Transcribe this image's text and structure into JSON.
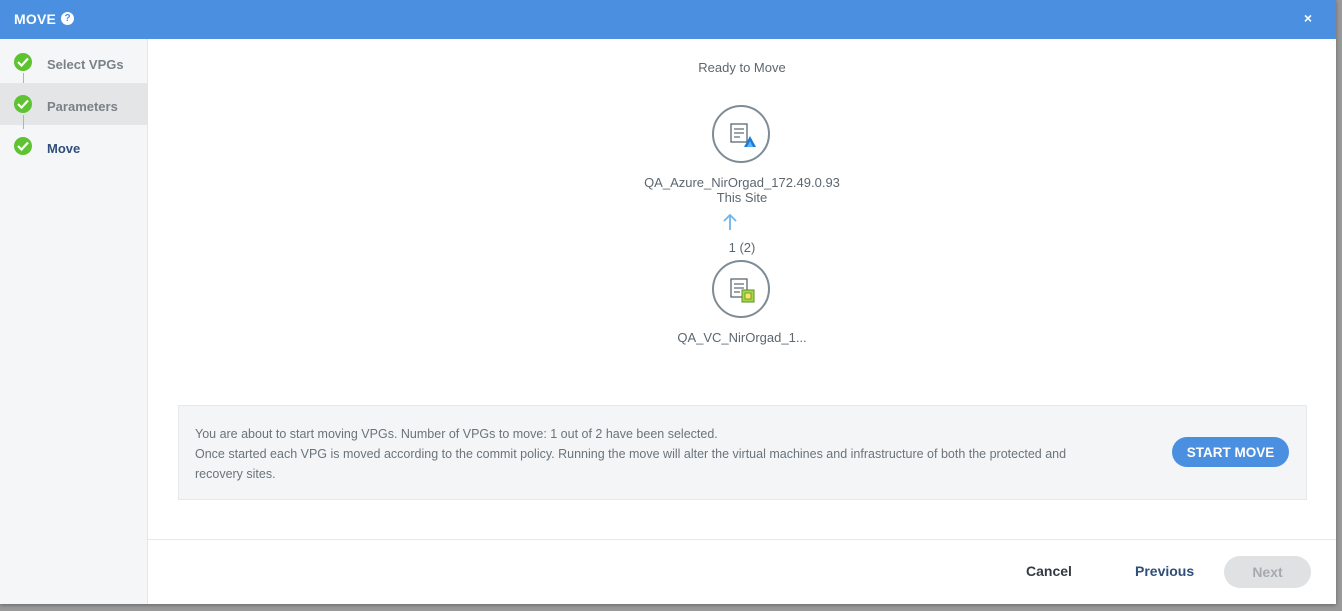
{
  "window": {
    "title": "MOVE",
    "help_icon": "question-circle-icon",
    "help_glyph": "?",
    "close_icon": "close-icon",
    "close_glyph": "×",
    "accent_color": "#4a8fe0"
  },
  "sidebar": {
    "steps": [
      {
        "label": "Select VPGs",
        "status": "complete"
      },
      {
        "label": "Parameters",
        "status": "complete"
      },
      {
        "label": "Move",
        "status": "current"
      }
    ],
    "check_color": "#5ec232"
  },
  "main": {
    "status_text": "Ready to Move",
    "target_site": {
      "name": "QA_Azure_NirOrgad_172.49.0.93",
      "subtitle": "This Site",
      "icon": "azure-site-icon"
    },
    "direction_icon": "arrow-up-icon",
    "vpg_count": "1 (2)",
    "source_site": {
      "name": "QA_VC_NirOrgad_1...",
      "icon": "vcenter-site-icon"
    }
  },
  "info": {
    "line1": "You are about to start moving VPGs. Number of VPGs to move: 1 out of 2 have been selected.",
    "line2": "Once started each VPG is moved according to the commit policy. Running the move will alter the virtual machines and infrastructure of both the protected and recovery sites.",
    "start_button": "START MOVE"
  },
  "footer": {
    "cancel": "Cancel",
    "previous": "Previous",
    "next": "Next"
  }
}
